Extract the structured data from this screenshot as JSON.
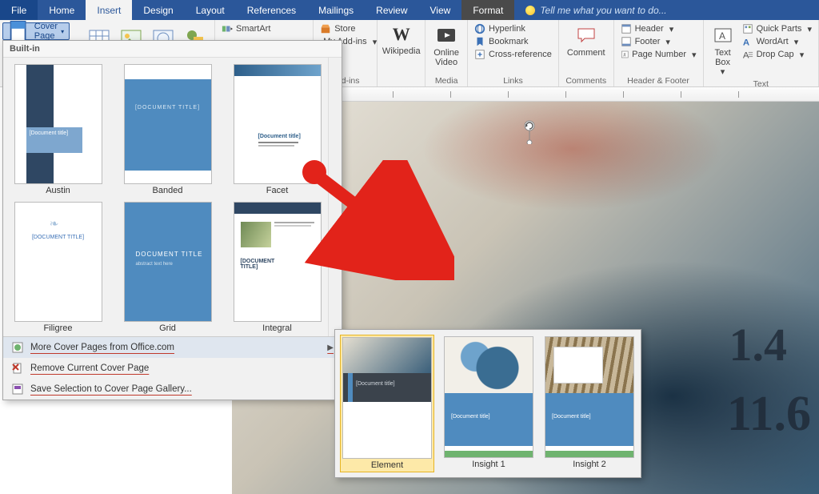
{
  "tabs": {
    "file": "File",
    "home": "Home",
    "insert": "Insert",
    "design": "Design",
    "layout": "Layout",
    "references": "References",
    "mailings": "Mailings",
    "review": "Review",
    "view": "View",
    "format": "Format",
    "tellme": "Tell me what you want to do..."
  },
  "ribbon": {
    "cover_page": "Cover Page",
    "smartart": "SmartArt",
    "store": "Store",
    "my_addins": "My Add-ins",
    "addins_group": "Add-ins",
    "wikipedia": "Wikipedia",
    "online_video": "Online Video",
    "media_group": "Media",
    "hyperlink": "Hyperlink",
    "bookmark": "Bookmark",
    "crossref": "Cross-reference",
    "links_group": "Links",
    "comment": "Comment",
    "comments_group": "Comments",
    "header": "Header",
    "footer": "Footer",
    "page_number": "Page Number",
    "hf_group": "Header & Footer",
    "text_box": "Text Box",
    "quick_parts": "Quick Parts",
    "wordart": "WordArt",
    "drop_cap": "Drop Cap",
    "text_group": "Text"
  },
  "dropdown": {
    "section": "Built-in",
    "templates": [
      {
        "name": "Austin"
      },
      {
        "name": "Banded"
      },
      {
        "name": "Facet"
      },
      {
        "name": "Filigree"
      },
      {
        "name": "Grid"
      },
      {
        "name": "Integral"
      }
    ],
    "more": "More Cover Pages from Office.com",
    "remove": "Remove Current Cover Page",
    "save": "Save Selection to Cover Page Gallery..."
  },
  "submenu": {
    "items": [
      {
        "name": "Element"
      },
      {
        "name": "Insight 1"
      },
      {
        "name": "Insight 2"
      }
    ]
  },
  "canvas_numbers": {
    "a": "1.4",
    "b": "11.6"
  },
  "thumb_text": {
    "doc_title": "[Document title]",
    "doc_title_caps": "[DOCUMENT TITLE]",
    "doc_title_mixed": "DOCUMENT TITLE"
  }
}
